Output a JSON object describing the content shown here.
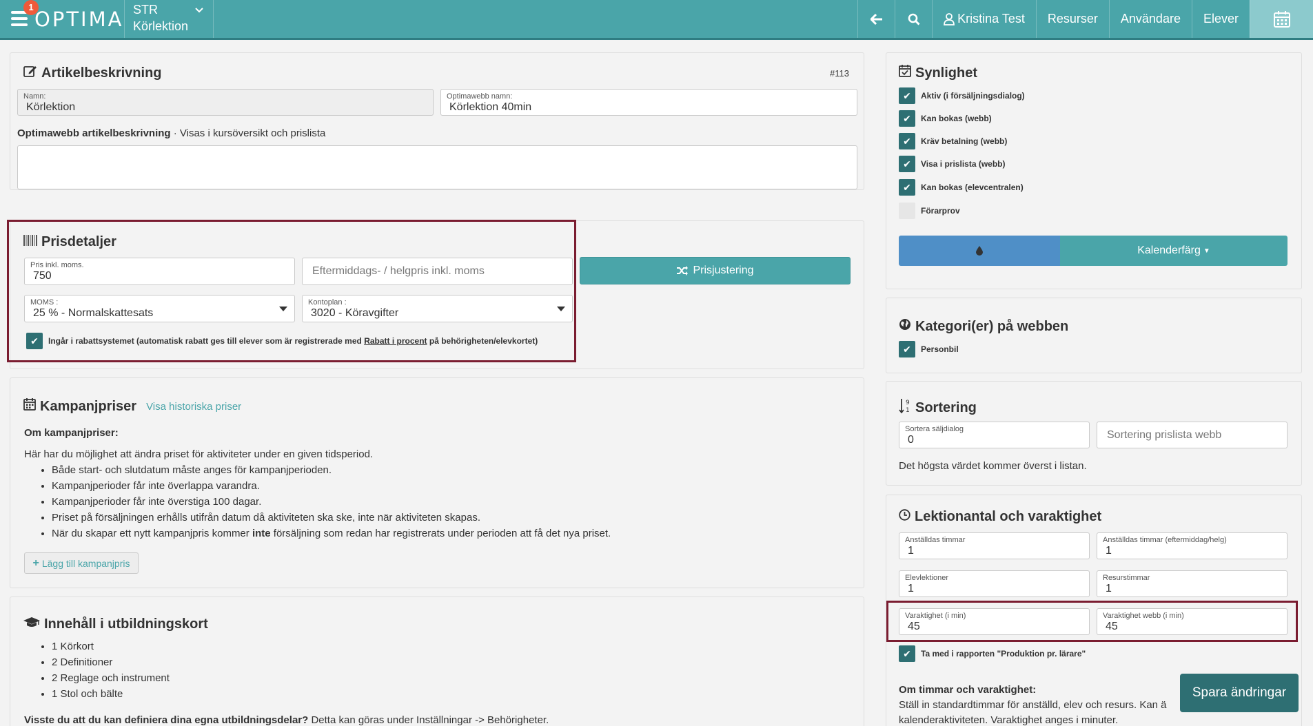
{
  "topbar": {
    "notification_count": "1",
    "logo": "OPTIMA",
    "context_line1": "STR",
    "context_line2": "Körlektion",
    "user": "Kristina Test",
    "nav_items": [
      "Resurser",
      "Användare",
      "Elever"
    ]
  },
  "article": {
    "title": "Artikelbeskrivning",
    "id": "#113",
    "name_label": "Namn:",
    "name_value": "Körlektion",
    "web_name_label": "Optimawebb namn:",
    "web_name_value": "Körlektion 40min",
    "desc_label": "Optimawebb artikelbeskrivning",
    "desc_hint": " · Visas i kursöversikt och prislista"
  },
  "price": {
    "title": "Prisdetaljer",
    "price_label": "Pris inkl. moms.",
    "price_value": "750",
    "afternoon_placeholder": "Eftermiddags- / helgpris inkl. moms",
    "adjust_button": "Prisjustering",
    "vat_label": "MOMS :",
    "vat_value": "25 % - Normalskattesats",
    "account_label": "Kontoplan :",
    "account_value": "3020 - Köravgifter",
    "discount_text_before": "Ingår i rabattsystemet (automatisk rabatt ges till elever som är registrerade med ",
    "discount_link": "Rabatt i procent",
    "discount_text_after": " på behörigheten/elevkortet)"
  },
  "campaign": {
    "title": "Kampanjpriser",
    "history_link": "Visa historiska priser",
    "about_heading": "Om kampanjpriser:",
    "intro": "Här har du möjlighet att ändra priset för aktiviteter under en given tidsperiod.",
    "bullets": [
      "Både start- och slutdatum måste anges för kampanjperioden.",
      "Kampanjperioder får inte överlappa varandra.",
      "Kampanjperioder får inte överstiga 100 dagar.",
      "Priset på försäljningen erhålls utifrån datum då aktiviteten ska ske, inte när aktiviteten skapas."
    ],
    "last_bullet_before": "När du skapar ett nytt kampanjpris kommer ",
    "last_bullet_bold": "inte",
    "last_bullet_after": " försäljning som redan har registrerats under perioden att få det nya priset.",
    "add_button": "Lägg till kampanjpris"
  },
  "education": {
    "title": "Innehåll i utbildningskort",
    "items": [
      "1 Körkort",
      "2 Definitioner",
      "2 Reglage och instrument",
      "1 Stol och bälte"
    ],
    "footer_bold": "Visste du att du kan definiera dina egna utbildningsdelar?",
    "footer_rest": " Detta kan göras under Inställningar -> Behörigheter."
  },
  "visibility": {
    "title": "Synlighet",
    "options": [
      {
        "label": "Aktiv (i försäljningsdialog)",
        "checked": true
      },
      {
        "label": "Kan bokas (webb)",
        "checked": true
      },
      {
        "label": "Kräv betalning (webb)",
        "checked": true
      },
      {
        "label": "Visa i prislista (webb)",
        "checked": true
      },
      {
        "label": "Kan bokas (elevcentralen)",
        "checked": true
      },
      {
        "label": "Förarprov",
        "checked": false
      }
    ],
    "calendar_color_button": "Kalenderfärg"
  },
  "categories": {
    "title": "Kategori(er) på webben",
    "items": [
      "Personbil"
    ]
  },
  "sorting": {
    "title": "Sortering",
    "sales_label": "Sortera säljdialog",
    "sales_value": "0",
    "pricelist_placeholder": "Sortering prislista webb",
    "note": "Det högsta värdet kommer överst i listan."
  },
  "duration": {
    "title": "Lektionantal och varaktighet",
    "employee_hours_label": "Anställdas timmar",
    "employee_hours_value": "1",
    "employee_hours_pm_label": "Anställdas timmar (eftermiddag/helg)",
    "employee_hours_pm_value": "1",
    "student_lessons_label": "Elevlektioner",
    "student_lessons_value": "1",
    "resource_hours_label": "Resurstimmar",
    "resource_hours_value": "1",
    "duration_label": "Varaktighet (i min)",
    "duration_value": "45",
    "web_duration_label": "Varaktighet webb (i min)",
    "web_duration_value": "45",
    "report_checkbox": "Ta med i rapporten \"Produktion pr. lärare\"",
    "about_heading": "Om timmar och varaktighet:",
    "about_line1": "Ställ in standardtimmar för anställd, elev och resurs. Kan ä",
    "about_line2": "kalenderaktiviteten. Varaktighet anges i minuter."
  },
  "save_button": "Spara ändringar"
}
